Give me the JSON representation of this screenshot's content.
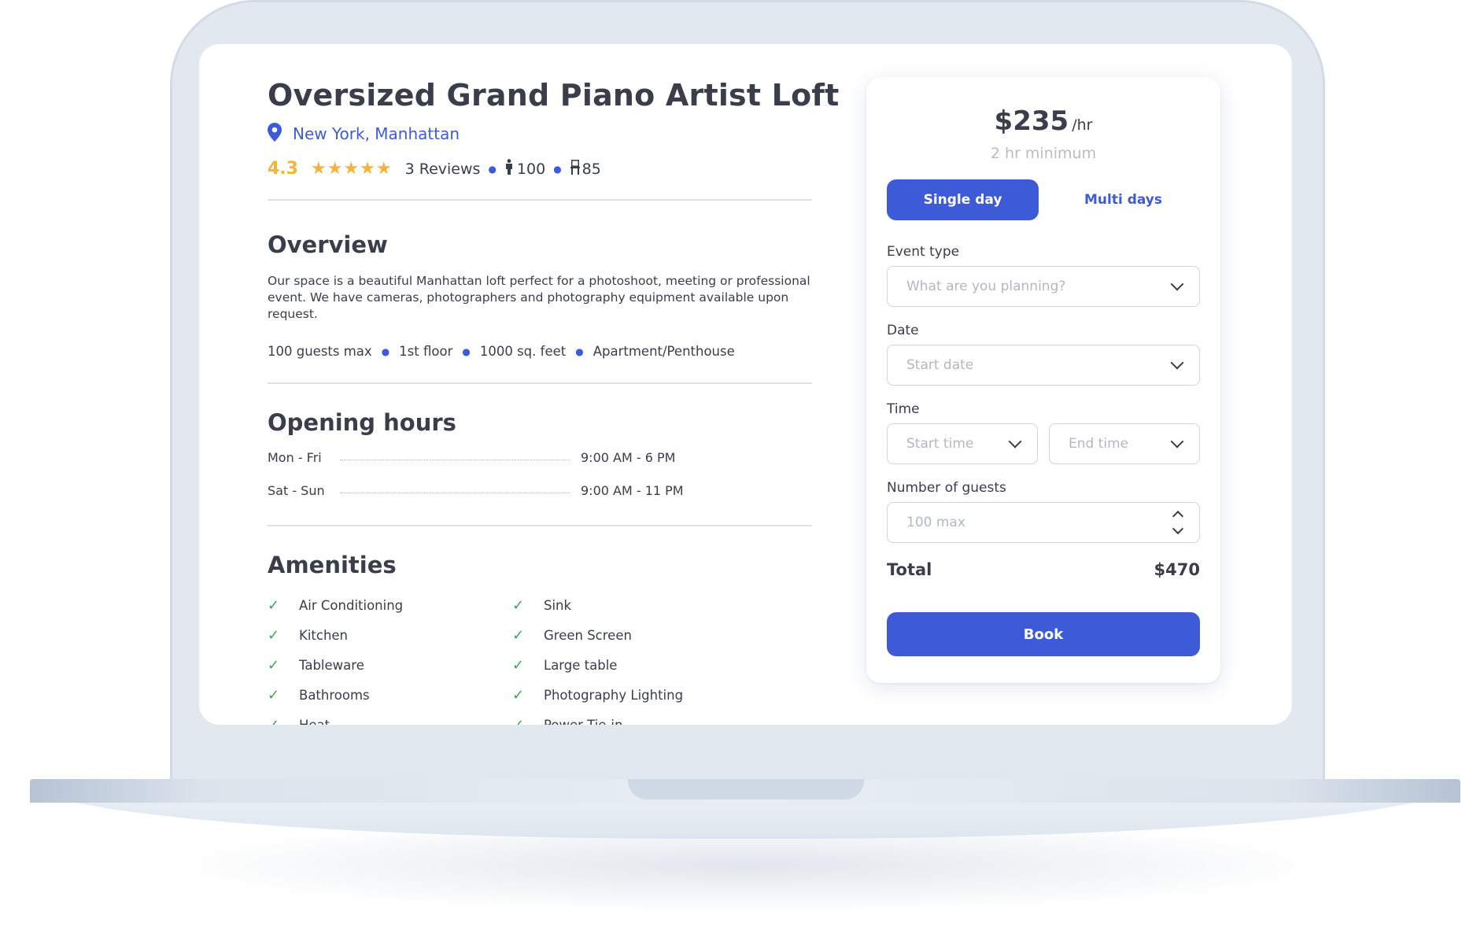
{
  "listing": {
    "title": "Oversized Grand Piano Artist Loft",
    "location": "New York, Manhattan",
    "rating": "4.3",
    "stars": "★★★★★",
    "reviews": "3 Reviews",
    "standing_capacity": "100",
    "seated_capacity": "85"
  },
  "overview": {
    "heading": "Overview",
    "text": "Our space is a beautiful Manhattan loft perfect for a photoshoot, meeting or professional event. We have cameras, photographers and photography equipment available upon request.",
    "specs": [
      "100 guests max",
      "1st floor",
      "1000 sq. feet",
      "Apartment/Penthouse"
    ]
  },
  "opening_hours": {
    "heading": "Opening hours",
    "rows": [
      {
        "day": "Mon - Fri",
        "hours": "9:00 AM - 6 PM"
      },
      {
        "day": "Sat - Sun",
        "hours": "9:00 AM - 11 PM"
      }
    ]
  },
  "amenities": {
    "heading": "Amenities",
    "left": [
      "Air Conditioning",
      "Kitchen",
      "Tableware",
      "Bathrooms",
      "Heat"
    ],
    "right": [
      "Sink",
      "Green Screen",
      "Large table",
      "Photography Lighting",
      "Power Tie-in"
    ]
  },
  "booking": {
    "price": "$235",
    "per": "/hr",
    "minimum": "2 hr minimum",
    "tab_single": "Single day",
    "tab_multi": "Multi days",
    "event_type_label": "Event type",
    "event_type_placeholder": "What are you planning?",
    "date_label": "Date",
    "date_placeholder": "Start date",
    "time_label": "Time",
    "start_time_placeholder": "Start time",
    "end_time_placeholder": "End time",
    "guests_label": "Number of guests",
    "guests_placeholder": "100 max",
    "total_label": "Total",
    "total_value": "$470",
    "book_label": "Book"
  },
  "colors": {
    "accent": "#3d5bd6",
    "star": "#f2b53a",
    "check": "#3aa35d",
    "text": "#3a3d4a"
  }
}
